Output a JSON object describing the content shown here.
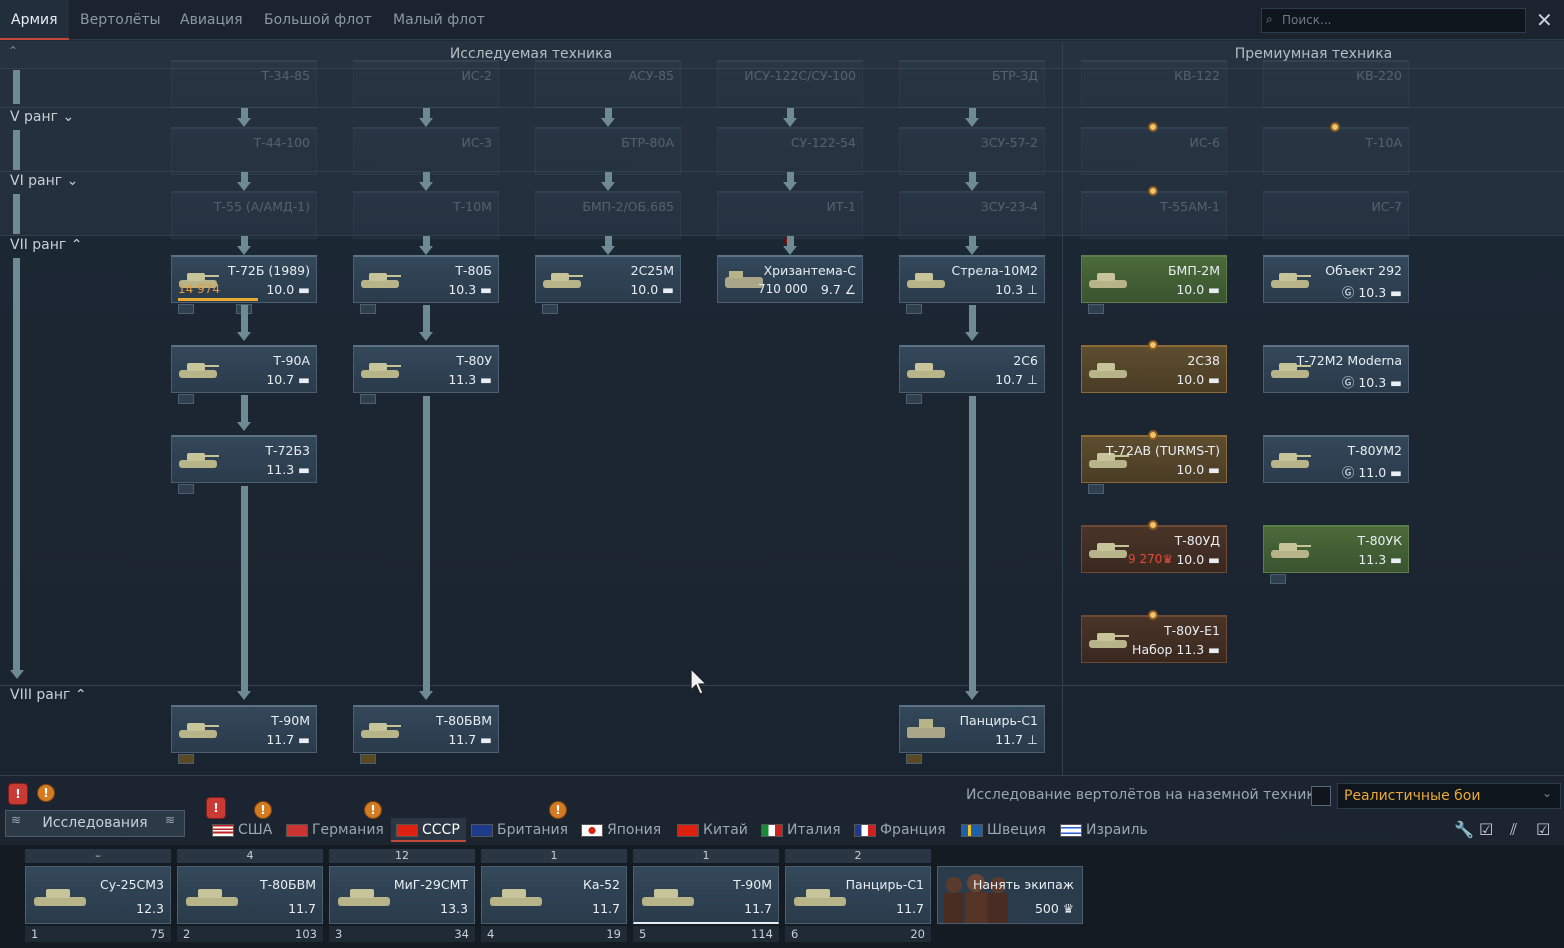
{
  "top_tabs": [
    "Армия",
    "Вертолёты",
    "Авиация",
    "Большой флот",
    "Малый флот"
  ],
  "search": {
    "placeholder": "Поиск..."
  },
  "columns": {
    "researched": "Исследуемая техника",
    "premium": "Премиумная техника"
  },
  "ranks": {
    "r5": "V ранг",
    "r6": "VI ранг",
    "r7": "VII ранг",
    "r8": "VIII ранг"
  },
  "faded_rows": {
    "row4": [
      "Т-34-85",
      "ИС-2",
      "АСУ-85",
      "ИСУ-122С/СУ-100",
      "БТР-ЗД",
      "КВ-122",
      "КВ-220"
    ],
    "row5": [
      "Т-44-100",
      "ИС-3",
      "БТР-80А",
      "СУ-122-54",
      "ЗСУ-57-2",
      "ИС-6",
      "Т-10А"
    ],
    "row6": [
      "Т-55 (А/АМД-1)",
      "Т-10М",
      "БМП-2/ОБ.685",
      "ИТ-1",
      "ЗСУ-23-4",
      "Т-55АМ-1",
      "ИС-7"
    ]
  },
  "vehicles": {
    "t72b": {
      "name": "Т-72Б (1989)",
      "br": "10.0",
      "extra": "14 974"
    },
    "t80b": {
      "name": "Т-80Б",
      "br": "10.3"
    },
    "s2s25m": {
      "name": "2С25М",
      "br": "10.0"
    },
    "khriz": {
      "name": "Хризантема-С",
      "br": "9.7",
      "extra": "710 000"
    },
    "strela": {
      "name": "Стрела-10М2",
      "br": "10.3"
    },
    "t90a": {
      "name": "Т-90А",
      "br": "10.7"
    },
    "t80u": {
      "name": "Т-80У",
      "br": "11.3"
    },
    "s2s6": {
      "name": "2С6",
      "br": "10.7"
    },
    "t72b3": {
      "name": "Т-72Б3",
      "br": "11.3"
    },
    "t90m": {
      "name": "Т-90М",
      "br": "11.7"
    },
    "t80bvm": {
      "name": "Т-80БВМ",
      "br": "11.7"
    },
    "pantsir": {
      "name": "Панцирь-С1",
      "br": "11.7"
    },
    "bmp2m": {
      "name": "БМП-2М",
      "br": "10.0"
    },
    "obj292": {
      "name": "Объект 292",
      "br": "10.3"
    },
    "s2s38": {
      "name": "2С38",
      "br": "10.0"
    },
    "t72m2": {
      "name": "Т-72М2 Moderna",
      "br": "10.3"
    },
    "t72av": {
      "name": "Т-72АВ (TURMS-T)",
      "br": "10.0"
    },
    "t80um2": {
      "name": "Т-80УМ2",
      "br": "11.0"
    },
    "t80ud": {
      "name": "Т-80УД",
      "br": "10.0",
      "extra": "9 270"
    },
    "t80uk": {
      "name": "Т-80УК",
      "br": "11.3"
    },
    "t80ue1": {
      "name": "Т-80У-Е1",
      "br": "Набор 11.3"
    }
  },
  "bottom": {
    "heli_research": "Исследование вертолётов на наземной технике",
    "mode": "Реалистичные бои",
    "research_button": "Исследования"
  },
  "nations": [
    "США",
    "Германия",
    "СССР",
    "Британия",
    "Япония",
    "Китай",
    "Италия",
    "Франция",
    "Швеция",
    "Израиль"
  ],
  "slots": [
    {
      "top": "–",
      "name": "Су-25СМ3",
      "br": "12.3",
      "num": "1",
      "pts": "75"
    },
    {
      "top": "4",
      "name": "Т-80БВМ",
      "br": "11.7",
      "num": "2",
      "pts": "103"
    },
    {
      "top": "12",
      "name": "МиГ-29СМТ",
      "br": "13.3",
      "num": "3",
      "pts": "34"
    },
    {
      "top": "1",
      "name": "Ка-52",
      "br": "11.7",
      "num": "4",
      "pts": "19"
    },
    {
      "top": "1",
      "name": "Т-90М",
      "br": "11.7",
      "num": "5",
      "pts": "114"
    },
    {
      "top": "2",
      "name": "Панцирь-С1",
      "br": "11.7",
      "num": "6",
      "pts": "20"
    }
  ],
  "hire_crew": {
    "label": "Нанять экипаж",
    "cost": "500"
  },
  "colors": {
    "accent": "#c24a3b",
    "gold": "#e8a935",
    "line": "#6e8a93"
  }
}
